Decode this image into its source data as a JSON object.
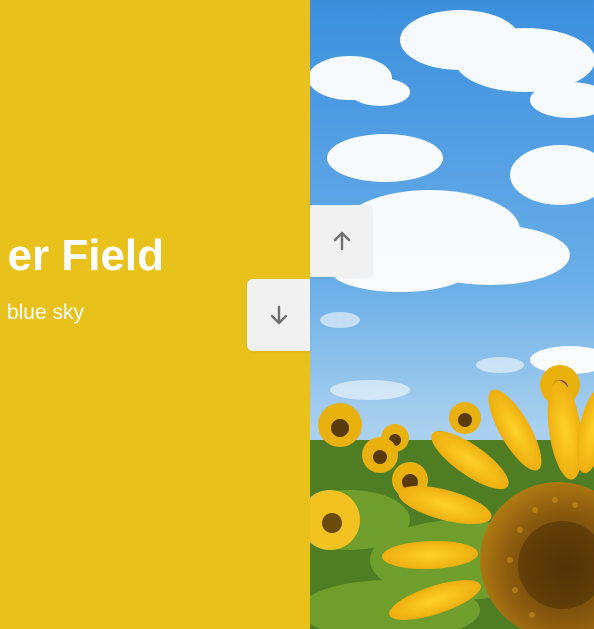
{
  "slide": {
    "title": "er Field",
    "subtitle": "blue sky"
  },
  "image": {
    "subject": "sunflower field under blue sky with clouds"
  },
  "controls": {
    "up_icon": "arrow-up-icon",
    "down_icon": "arrow-down-icon"
  },
  "colors": {
    "panel_bg": "#e8c11b",
    "text": "#ffffff",
    "button_bg": "#f1f1f1",
    "icon": "#6f6f6f",
    "sky_top": "#3d93e0",
    "sky_bottom": "#9fcbed"
  }
}
